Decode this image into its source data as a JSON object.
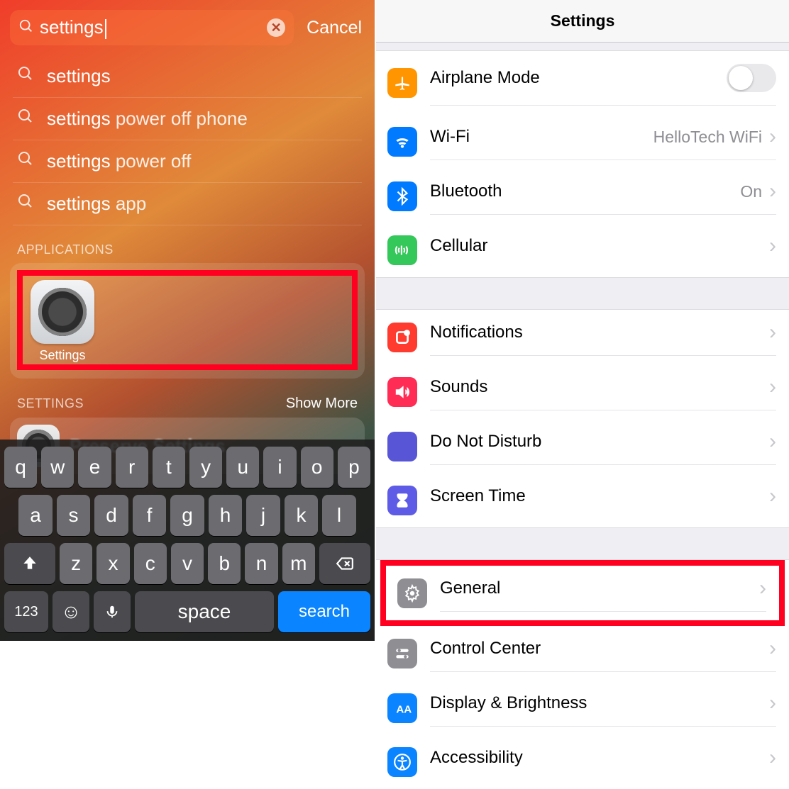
{
  "left": {
    "search_value": "settings",
    "cancel": "Cancel",
    "suggestions": [
      {
        "bold": "settings",
        "rest": ""
      },
      {
        "bold": "settings",
        "rest": " power off phone"
      },
      {
        "bold": "settings",
        "rest": " power off"
      },
      {
        "bold": "settings",
        "rest": " app"
      }
    ],
    "applications_header": "APPLICATIONS",
    "app_label": "Settings",
    "settings_header": "SETTINGS",
    "show_more": "Show More",
    "preserve": "Preserve Settings",
    "keyboard": {
      "row1": [
        "q",
        "w",
        "e",
        "r",
        "t",
        "y",
        "u",
        "i",
        "o",
        "p"
      ],
      "row2": [
        "a",
        "s",
        "d",
        "f",
        "g",
        "h",
        "j",
        "k",
        "l"
      ],
      "row3": [
        "z",
        "x",
        "c",
        "v",
        "b",
        "n",
        "m"
      ],
      "num": "123",
      "space": "space",
      "search": "search"
    }
  },
  "right": {
    "title": "Settings",
    "group1": [
      {
        "icon": "airplane-icon",
        "bg": "bg-orange",
        "label": "Airplane Mode",
        "type": "toggle"
      },
      {
        "icon": "wifi-icon",
        "bg": "bg-blue",
        "label": "Wi-Fi",
        "value": "HelloTech WiFi",
        "type": "link"
      },
      {
        "icon": "bluetooth-icon",
        "bg": "bg-blue",
        "label": "Bluetooth",
        "value": "On",
        "type": "link"
      },
      {
        "icon": "cellular-icon",
        "bg": "bg-green",
        "label": "Cellular",
        "type": "link"
      }
    ],
    "group2": [
      {
        "icon": "notifications-icon",
        "bg": "bg-red",
        "label": "Notifications",
        "type": "link"
      },
      {
        "icon": "sounds-icon",
        "bg": "bg-pink",
        "label": "Sounds",
        "type": "link"
      },
      {
        "icon": "dnd-icon",
        "bg": "bg-purple",
        "label": "Do Not Disturb",
        "type": "link"
      },
      {
        "icon": "screentime-icon",
        "bg": "bg-indigo",
        "label": "Screen Time",
        "type": "link"
      }
    ],
    "group3": [
      {
        "icon": "general-icon",
        "bg": "bg-gray",
        "label": "General",
        "type": "link",
        "highlight": true
      },
      {
        "icon": "control-center-icon",
        "bg": "bg-gray",
        "label": "Control Center",
        "type": "link"
      },
      {
        "icon": "display-icon",
        "bg": "bg-bright-blue",
        "label": "Display & Brightness",
        "type": "link"
      },
      {
        "icon": "accessibility-icon",
        "bg": "bg-bright-blue",
        "label": "Accessibility",
        "type": "link"
      }
    ]
  }
}
